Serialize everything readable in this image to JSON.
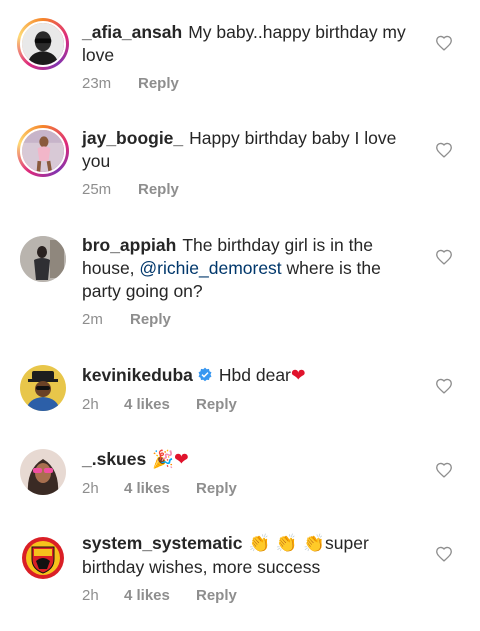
{
  "comments": [
    {
      "username": "_afia_ansah",
      "text": "My baby..happy birthday my love",
      "time": "23m",
      "likes": "",
      "reply": "Reply",
      "avatar_icon": "man-sunglasses-avatar",
      "story_ring": true
    },
    {
      "username": "jay_boogie_",
      "text": "Happy birthday baby I love you",
      "time": "25m",
      "likes": "",
      "reply": "Reply",
      "avatar_icon": "woman-pink-avatar",
      "story_ring": true
    },
    {
      "username": "bro_appiah",
      "text_before": "The birthday girl is in the house, ",
      "mention": "@richie_demorest",
      "text_after": " where is the party going on?",
      "time": "2m",
      "likes": "",
      "reply": "Reply",
      "avatar_icon": "man-dark-room-avatar",
      "story_ring": false
    },
    {
      "username": "kevinikeduba",
      "verified": true,
      "text": "Hbd dear",
      "emoji": "❤",
      "time": "2h",
      "likes": "4 likes",
      "reply": "Reply",
      "avatar_icon": "man-hat-avatar",
      "story_ring": false
    },
    {
      "username": "_.skues",
      "text": "",
      "emoji_party": "🎉",
      "emoji": "❤",
      "time": "2h",
      "likes": "4 likes",
      "reply": "Reply",
      "avatar_icon": "woman-pink-glasses-avatar",
      "story_ring": false
    },
    {
      "username": "system_systematic",
      "emoji_claps": "👏 👏 👏",
      "text": "super birthday wishes, more success",
      "time": "2h",
      "likes": "4 likes",
      "reply": "Reply",
      "avatar_icon": "manchester-united-crest-avatar",
      "story_ring": false
    }
  ],
  "colors": {
    "text": "#262626",
    "meta": "#8e8e8e",
    "mention": "#00376b",
    "verified": "#3897f0",
    "heart_red": "#e0132c"
  },
  "icons": {
    "like": "heart-outline-icon",
    "verified": "verified-badge-icon"
  }
}
